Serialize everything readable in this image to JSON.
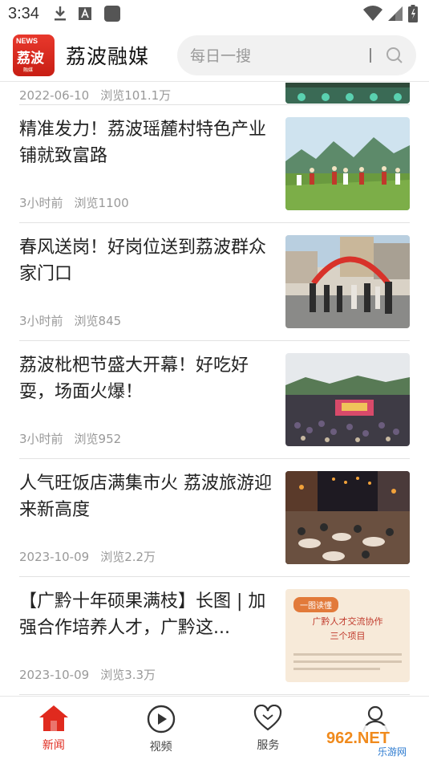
{
  "status_bar": {
    "time": "3:34",
    "left_icons": [
      "download-icon",
      "a-badge-icon",
      "app-square-icon"
    ],
    "right_icons": [
      "wifi-icon",
      "signal-icon",
      "battery-icon"
    ]
  },
  "header": {
    "logo": {
      "top_text": "NEWS",
      "name": "荔波",
      "sub": "融媒"
    },
    "title": "荔波融媒",
    "search": {
      "placeholder": "每日一搜",
      "icon": "search-icon"
    }
  },
  "feed": {
    "partial_item": {
      "date": "2022-06-10",
      "views": "浏览101.1万"
    },
    "items": [
      {
        "title": "精准发力！荔波瑶麓村特色产业铺就致富路",
        "time": "3小时前",
        "views": "浏览1100"
      },
      {
        "title": "春风送岗！好岗位送到荔波群众家门口",
        "time": "3小时前",
        "views": "浏览845"
      },
      {
        "title": "荔波枇杷节盛大开幕！好吃好耍，场面火爆！",
        "time": "3小时前",
        "views": "浏览952"
      },
      {
        "title": "人气旺饭店满集市火 荔波旅游迎来新高度",
        "time": "2023-10-09",
        "views": "浏览2.2万"
      },
      {
        "title": "【广黔十年硕果满枝】长图 | 加强合作培养人才，广黔这...",
        "time": "2023-10-09",
        "views": "浏览3.3万"
      }
    ],
    "thumb5": {
      "badge": "一图读懂",
      "line1": "广黔人才交流协作",
      "line2": "三个项目"
    }
  },
  "bottom_nav": [
    {
      "label": "新闻",
      "icon": "home-icon",
      "active": true
    },
    {
      "label": "视频",
      "icon": "play-circle-icon",
      "active": false
    },
    {
      "label": "服务",
      "icon": "heart-icon",
      "active": false
    },
    {
      "label": "",
      "icon": "user-icon",
      "active": false
    }
  ],
  "watermark": {
    "text": "962.NET",
    "sub": "乐游网"
  },
  "colors": {
    "accent": "#e02a1e",
    "meta": "#999999",
    "divider": "#e2e2e2"
  }
}
